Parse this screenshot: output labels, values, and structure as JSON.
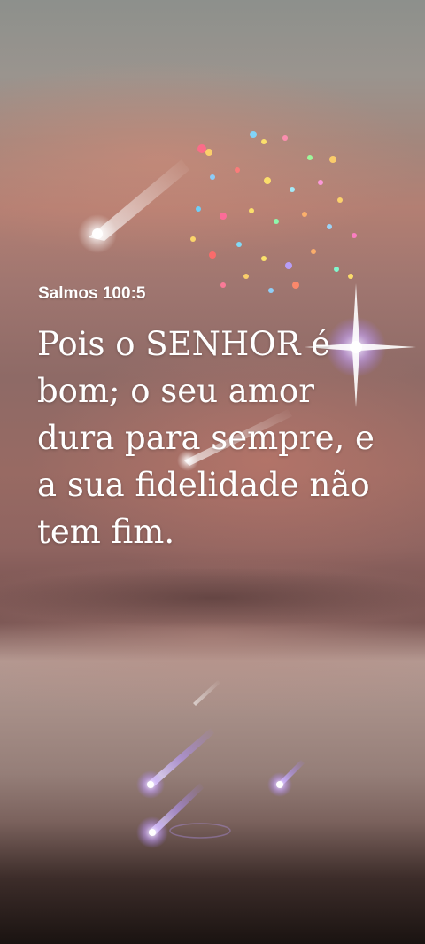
{
  "verse": {
    "reference": "Salmos 100:5",
    "text": "Pois o SENHOR é bom; o seu amor dura para sempre, e a sua fidelidade não tem fim."
  },
  "colors": {
    "text": "#ffffff",
    "sky_top": "#8d908c",
    "sky_pink": "#b37f73",
    "bottom": "#1a1311"
  }
}
